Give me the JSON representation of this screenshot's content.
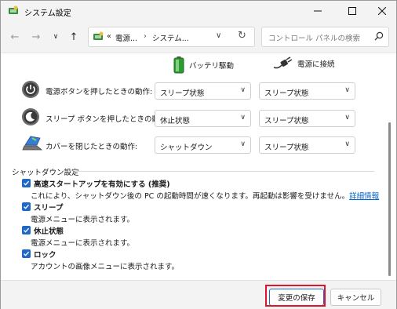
{
  "window": {
    "title": "システム設定"
  },
  "address": {
    "overflow": "«",
    "crumbs": [
      "電源...",
      "システム..."
    ]
  },
  "search": {
    "placeholder": "コントロール パネルの検索"
  },
  "columns": {
    "battery": "バッテリ駆動",
    "plugged": "電源に接続"
  },
  "rows": [
    {
      "label": "電源ボタンを押したときの動作:",
      "battery": "スリープ状態",
      "plugged": "スリープ状態",
      "icon": "power-button-icon"
    },
    {
      "label": "スリープ ボタンを押したときの動作:",
      "battery": "休止状態",
      "plugged": "スリープ状態",
      "icon": "sleep-button-icon"
    },
    {
      "label": "カバーを閉じたときの動作:",
      "battery": "シャットダウン",
      "plugged": "スリープ状態",
      "icon": "laptop-lid-icon"
    }
  ],
  "shutdown": {
    "title": "シャットダウン設定",
    "options": [
      {
        "title": "高速スタートアップを有効にする (推奨)",
        "desc": "これにより、シャットダウン後の PC の起動時間が速くなります。再起動は影響を受けません。",
        "link": "詳細情報",
        "checked": true
      },
      {
        "title": "スリープ",
        "desc": "電源メニューに表示されます。",
        "checked": true
      },
      {
        "title": "休止状態",
        "desc": "電源メニューに表示されます。",
        "checked": true
      },
      {
        "title": "ロック",
        "desc": "アカウントの画像メニューに表示されます。",
        "checked": true
      }
    ]
  },
  "buttons": {
    "save": "変更の保存",
    "cancel": "キャンセル"
  },
  "colors": {
    "accent": "#1f68c8",
    "highlight": "#e0142b",
    "link": "#0066cc"
  }
}
